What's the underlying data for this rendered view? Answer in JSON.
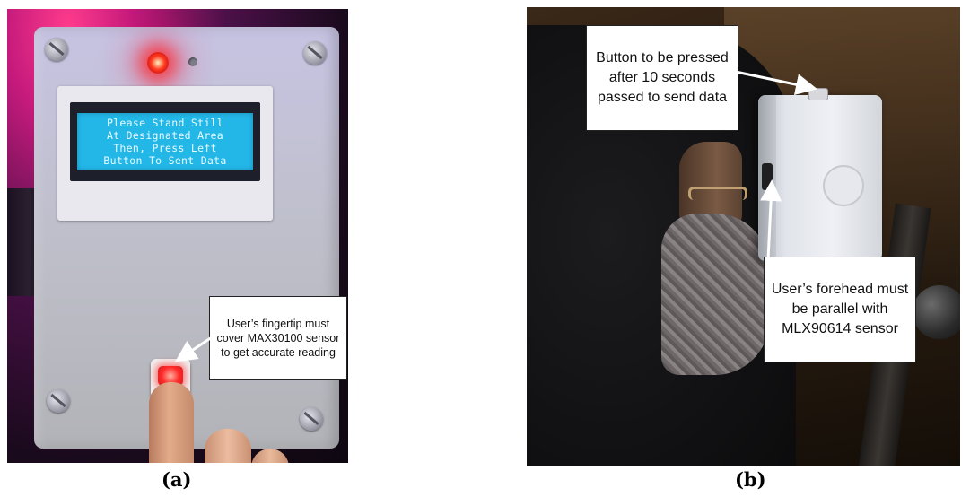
{
  "panel_a": {
    "lcd_lines": [
      "Please Stand Still",
      "At Designated Area",
      "Then, Press Left",
      "Button To Sent Data"
    ],
    "callout": "User’s fingertip must cover MAX30100 sensor to get accurate reading",
    "caption": "(a)"
  },
  "panel_b": {
    "callout_button": "Button to be pressed after 10 seconds passed to send data",
    "callout_sensor": "User’s forehead must be parallel with MLX90614 sensor",
    "caption": "(b)"
  },
  "colors": {
    "lcd_background": "#23b7e8",
    "led_red": "#ff3a20",
    "enclosure": "#c3c2d6",
    "callout_border": "#222222"
  }
}
